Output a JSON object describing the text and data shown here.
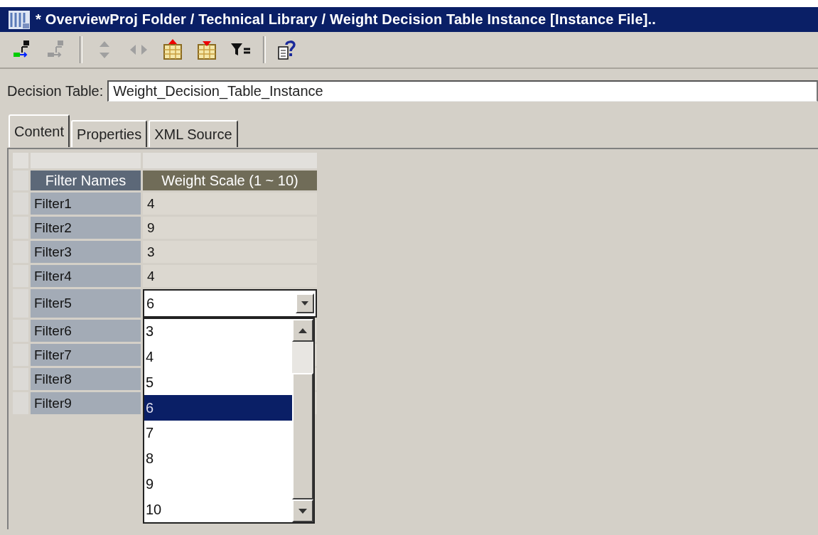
{
  "window": {
    "title": "* OverviewProj Folder / Technical Library / Weight Decision Table Instance [Instance File].."
  },
  "toolbar": [
    {
      "kind": "link",
      "disabled": false
    },
    {
      "kind": "link",
      "disabled": true
    },
    {
      "kind": "separator"
    },
    {
      "kind": "updown",
      "disabled": true
    },
    {
      "kind": "leftright",
      "disabled": true
    },
    {
      "kind": "insert-above",
      "disabled": false
    },
    {
      "kind": "insert-below",
      "disabled": false
    },
    {
      "kind": "filter",
      "disabled": false
    },
    {
      "kind": "separator"
    },
    {
      "kind": "help",
      "disabled": false
    }
  ],
  "name_field": {
    "label": "Decision Table:",
    "value": "Weight_Decision_Table_Instance"
  },
  "tabs": [
    {
      "label": "Content",
      "selected": true
    },
    {
      "label": "Properties",
      "selected": false
    },
    {
      "label": "XML Source",
      "selected": false
    }
  ],
  "table": {
    "columns": [
      "Filter Names",
      "Weight Scale (1 ~ 10)"
    ],
    "rows": [
      {
        "name": "Filter1",
        "value": "4"
      },
      {
        "name": "Filter2",
        "value": "9"
      },
      {
        "name": "Filter3",
        "value": "3"
      },
      {
        "name": "Filter4",
        "value": "4"
      },
      {
        "name": "Filter5",
        "kind": "combo",
        "value": "6"
      },
      {
        "name": "Filter6"
      },
      {
        "name": "Filter7"
      },
      {
        "name": "Filter8"
      },
      {
        "name": "Filter9"
      }
    ]
  },
  "dropdown": {
    "options": [
      {
        "label": "3",
        "selected": false
      },
      {
        "label": "4",
        "selected": false
      },
      {
        "label": "5",
        "selected": false
      },
      {
        "label": "6",
        "selected": true
      },
      {
        "label": "7",
        "selected": false
      },
      {
        "label": "8",
        "selected": false
      },
      {
        "label": "9",
        "selected": false
      },
      {
        "label": "10",
        "selected": false
      }
    ]
  }
}
